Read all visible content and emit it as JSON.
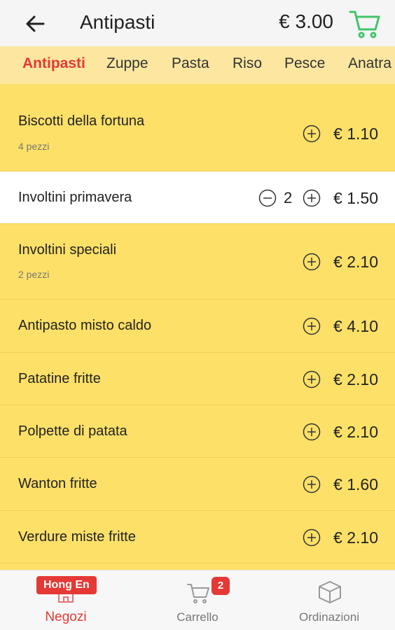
{
  "header": {
    "title": "Antipasti",
    "total": "€ 3.00"
  },
  "categories": [
    "Antipasti",
    "Zuppe",
    "Pasta",
    "Riso",
    "Pesce",
    "Anatra"
  ],
  "items": [
    {
      "name": "Biscotti della fortuna",
      "sub": "4 pezzi",
      "price": "€ 1.10",
      "qty": ""
    },
    {
      "name": "Involtini primavera",
      "sub": "",
      "price": "€ 1.50",
      "qty": "2"
    },
    {
      "name": "Involtini speciali",
      "sub": "2 pezzi",
      "price": "€ 2.10",
      "qty": ""
    },
    {
      "name": "Antipasto misto caldo",
      "sub": "",
      "price": "€ 4.10",
      "qty": ""
    },
    {
      "name": "Patatine fritte",
      "sub": "",
      "price": "€ 2.10",
      "qty": ""
    },
    {
      "name": "Polpette di patata",
      "sub": "",
      "price": "€ 2.10",
      "qty": ""
    },
    {
      "name": "Wanton fritte",
      "sub": "",
      "price": "€ 1.60",
      "qty": ""
    },
    {
      "name": "Verdure miste fritte",
      "sub": "",
      "price": "€ 2.10",
      "qty": ""
    }
  ],
  "bottom_nav": {
    "shop": {
      "label": "Negozi",
      "badge": "Hong En"
    },
    "cart": {
      "label": "Carrello",
      "badge": "2"
    },
    "orders": {
      "label": "Ordinazioni"
    }
  },
  "colors": {
    "accent": "#e53935",
    "list_bg": "#fde068",
    "tabs_bg": "#fde7a0",
    "cart_green": "#43c46b"
  }
}
